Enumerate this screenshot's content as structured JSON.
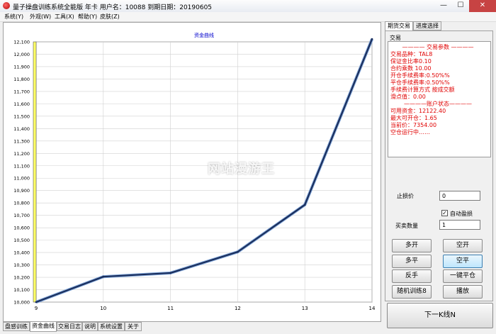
{
  "window": {
    "title": "量子操盘训练系统全能版 年卡 用户名：10088 到期日期：20190605",
    "min_glyph": "—",
    "max_glyph": "☐",
    "close_glyph": "✕"
  },
  "menu": [
    "系统(Y)",
    "外观(W)",
    "工具(X)",
    "帮助(Y)",
    "皮肤(Z)"
  ],
  "bottom_tabs": [
    "盘感训练",
    "资金曲线",
    "交易日志",
    "说明",
    "系统设置",
    "关于"
  ],
  "bottom_tabs_active": 1,
  "right_tabs": [
    "期货交易",
    "进度选择"
  ],
  "right_tabs_active": 0,
  "trade_group_label": "交易",
  "info": {
    "params_header": "———— 交易参数 ————",
    "lines1": [
      "交易品种：TAL8",
      "保证金比率0.10",
      "  合约乘数  10.00",
      "开仓手续费率:0.50%%",
      " 平仓手续费率:0.50%%",
      "  手续费计算方式 按成交额",
      "滑点值：0.00"
    ],
    "account_header": "————账户状态————",
    "lines2": [
      "可用资金：12122.40",
      "最大可开仓：1.65",
      "当前价：7354.00",
      "空仓运行中……"
    ]
  },
  "stop_loss": {
    "label": "止损价",
    "value": "0"
  },
  "auto_stop": {
    "label": "自动盈损",
    "checked": true,
    "check_glyph": "✓"
  },
  "quantity": {
    "label": "买卖数量",
    "value": "1"
  },
  "buttons": {
    "open_long": "多开",
    "open_short": "空开",
    "close_long": "多平",
    "close_short": "空平",
    "reverse": "反手",
    "close_all": "一键平仓",
    "random_train": "随机训练8",
    "playback": "播放"
  },
  "next_button": "下一K线N",
  "watermark": "网站漫游王",
  "chart_data": {
    "type": "line",
    "title": "资金曲线",
    "xlabel": "",
    "ylabel": "",
    "x": [
      9,
      10,
      11,
      12,
      13,
      14
    ],
    "series": [
      {
        "values": [
          10000,
          10205,
          10235,
          10405,
          10785,
          12122
        ]
      }
    ],
    "xlim": [
      9,
      14
    ],
    "ylim": [
      10000,
      12100
    ],
    "yticks": [
      10000,
      10100,
      10200,
      10300,
      10400,
      10500,
      10600,
      10700,
      10800,
      10900,
      11000,
      11100,
      11200,
      11300,
      11400,
      11500,
      11600,
      11700,
      11800,
      11900,
      12000,
      12100
    ],
    "ytick_labels": [
      "10,000",
      "10,100",
      "10,200",
      "10,300",
      "10,400",
      "10,500",
      "10,600",
      "10,700",
      "10,800",
      "10,900",
      "11,000",
      "11,100",
      "11,200",
      "11,300",
      "11,400",
      "11,500",
      "11,600",
      "11,700",
      "11,800",
      "11,900",
      "12,000",
      "12,100"
    ],
    "grid": true,
    "line_color": "#1a2e5c",
    "axis_bar_color": "#ffff66",
    "title_color": "#0000cc"
  }
}
